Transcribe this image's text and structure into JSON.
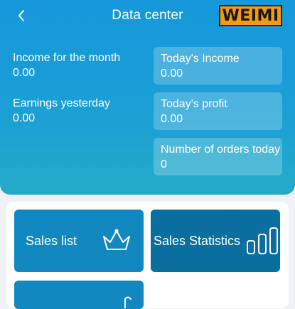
{
  "header": {
    "title": "Data center",
    "logo_text": "WEIMI"
  },
  "stats": {
    "income_month": {
      "label": "Income for the month",
      "value": "0.00"
    },
    "earnings_yesterday": {
      "label": "Earnings yesterday",
      "value": "0.00"
    },
    "today_income": {
      "label": "Today's Income",
      "value": "0.00"
    },
    "today_profit": {
      "label": "Today's profit",
      "value": "0.00"
    },
    "orders_today": {
      "label": "Number of orders today",
      "value": "0"
    }
  },
  "menu": {
    "sales_list": "Sales list",
    "sales_statistics": "Sales Statistics"
  },
  "colors": {
    "header_top": "#1698db",
    "header_bottom": "#24abc8",
    "card_blue": "#1189c0",
    "card_dark": "#0a6f9f",
    "logo_bg": "#f39a10"
  }
}
